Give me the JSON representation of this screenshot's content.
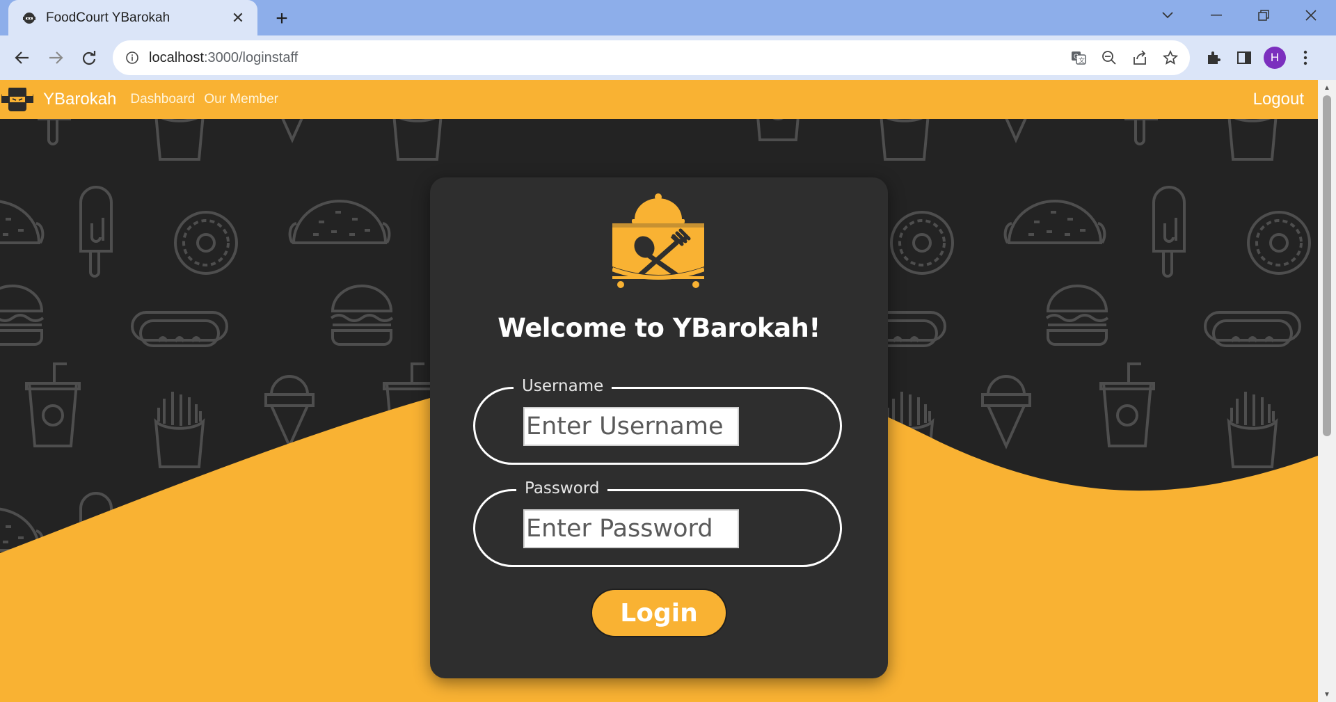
{
  "browser": {
    "tab_title": "FoodCourt YBarokah",
    "url_host": "localhost",
    "url_path": ":3000/loginstaff",
    "profile_initial": "H"
  },
  "site": {
    "brand": "YBarokah",
    "nav_links": [
      "Dashboard",
      "Our Member"
    ],
    "logout": "Logout"
  },
  "login": {
    "title": "Welcome to YBarokah!",
    "username_label": "Username",
    "username_placeholder": "Enter Username",
    "username_value": "",
    "password_label": "Password",
    "password_placeholder": "Enter Password",
    "password_value": "",
    "submit_label": "Login"
  },
  "colors": {
    "accent": "#f9b233",
    "background": "#232323",
    "card": "#2e2e2e",
    "pattern_stroke": "#4e4e4e"
  }
}
